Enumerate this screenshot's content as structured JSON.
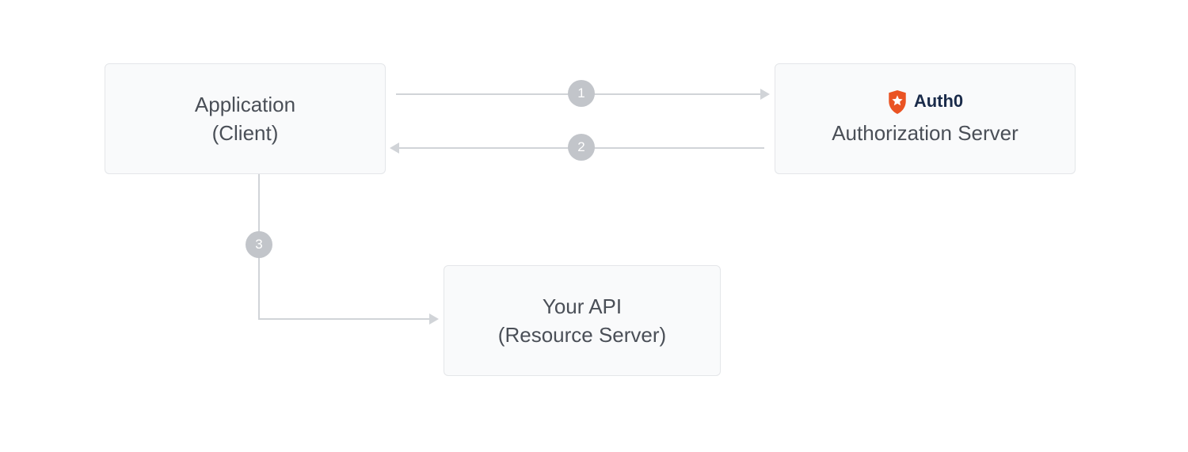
{
  "boxes": {
    "client": {
      "line1": "Application",
      "line2": "(Client)"
    },
    "authserver": {
      "logo_label": "Auth0",
      "line1": "Authorization Server"
    },
    "api": {
      "line1": "Your API",
      "line2": "(Resource Server)"
    }
  },
  "steps": {
    "one": "1",
    "two": "2",
    "three": "3"
  },
  "colors": {
    "box_bg": "#f9fafb",
    "box_border": "#e4e6e9",
    "arrow": "#d1d4d8",
    "badge": "#c2c5ca",
    "text": "#4a4f57",
    "logo_orange": "#ea5323",
    "logo_text": "#1a2b4a"
  }
}
